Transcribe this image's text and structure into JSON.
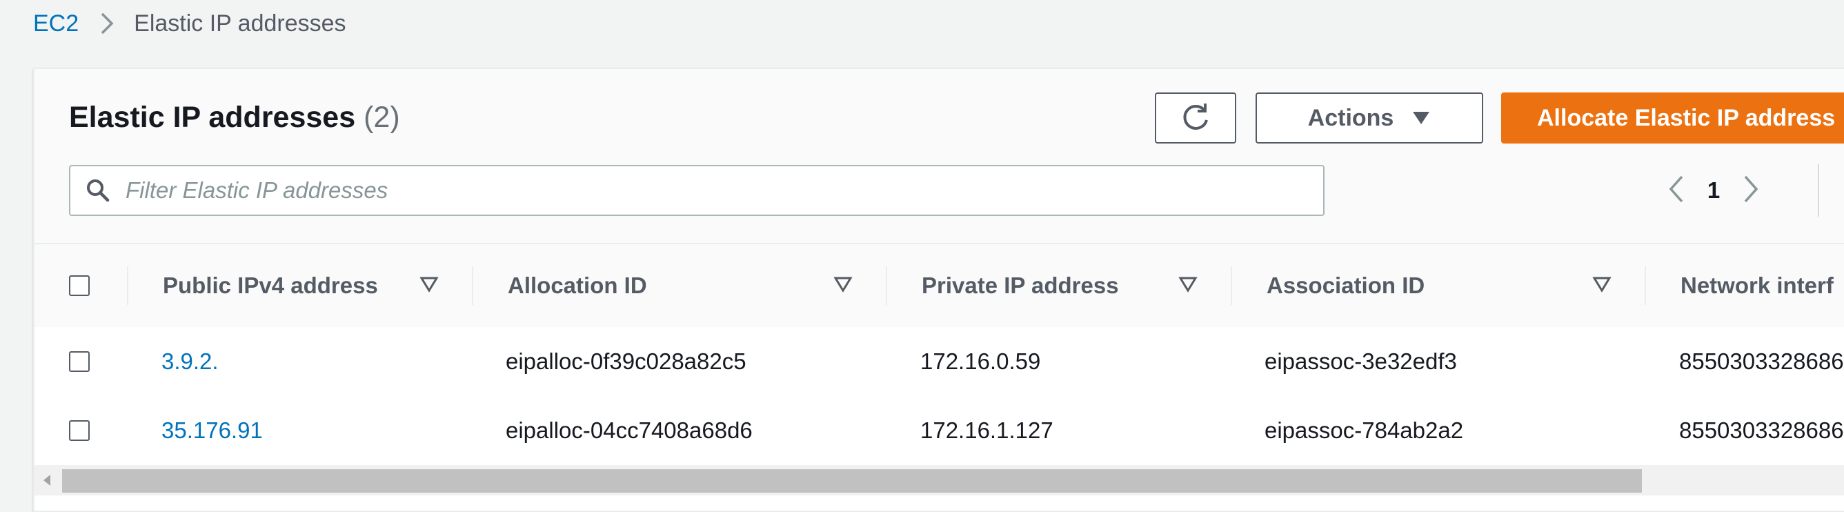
{
  "breadcrumb": {
    "root": "EC2",
    "current": "Elastic IP addresses"
  },
  "header": {
    "title": "Elastic IP addresses",
    "count": "(2)",
    "actions_label": "Actions",
    "allocate_label": "Allocate Elastic IP address"
  },
  "filter": {
    "placeholder": "Filter Elastic IP addresses",
    "value": ""
  },
  "pagination": {
    "page": "1"
  },
  "table": {
    "columns": [
      "Public IPv4 address",
      "Allocation ID",
      "Private IP address",
      "Association ID",
      "Network interf"
    ],
    "rows": [
      {
        "public_ip": "3.9.2.",
        "allocation_id": "eipalloc-0f39c028a82c5",
        "private_ip": "172.16.0.59",
        "association_id": "eipassoc-3e32edf3",
        "network_interface": "8550303328686"
      },
      {
        "public_ip": "35.176.91",
        "allocation_id": "eipalloc-04cc7408a68d6",
        "private_ip": "172.16.1.127",
        "association_id": "eipassoc-784ab2a2",
        "network_interface": "8550303328686"
      }
    ]
  },
  "colors": {
    "link": "#0073bb",
    "primary": "#ec7211",
    "text": "#16191f",
    "muted": "#545b64"
  },
  "icons": [
    "chevron-right-icon",
    "refresh-icon",
    "caret-down-icon",
    "search-icon",
    "chevron-left-icon",
    "gear-icon",
    "sort-icon",
    "scroll-left-icon"
  ]
}
